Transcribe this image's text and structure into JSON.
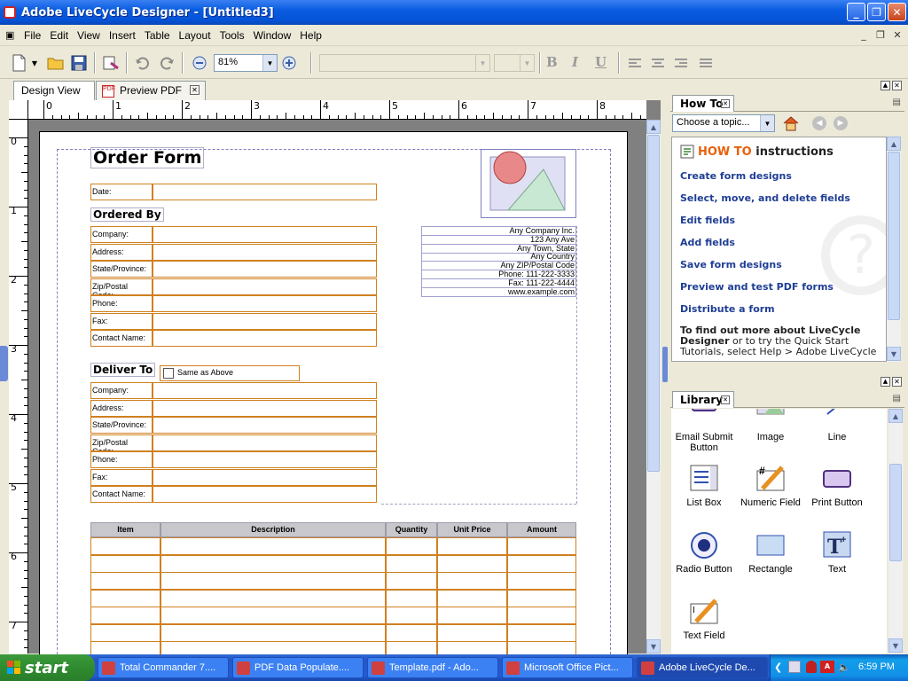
{
  "window": {
    "title": "Adobe LiveCycle Designer - [Untitled3]"
  },
  "menu": [
    "File",
    "Edit",
    "View",
    "Insert",
    "Table",
    "Layout",
    "Tools",
    "Window",
    "Help"
  ],
  "toolbar": {
    "zoom": "81%"
  },
  "tabs": [
    {
      "label": "Design View"
    },
    {
      "label": "Preview PDF"
    }
  ],
  "ruler": {
    "h_numbers": [
      "0",
      "1",
      "2",
      "3",
      "4",
      "5",
      "6",
      "7",
      "8"
    ],
    "v_numbers": [
      "0",
      "1",
      "2",
      "3",
      "4",
      "5",
      "6",
      "7"
    ]
  },
  "form": {
    "title": "Order Form",
    "date_label": "Date:",
    "ordered_by": "Ordered By",
    "deliver_to": "Deliver To",
    "same_as_above": "Same as Above",
    "address_fields": [
      "Company:",
      "Address:",
      "State/Province:",
      "Zip/Postal Code:",
      "Phone:",
      "Fax:",
      "Contact Name:"
    ],
    "company_info": [
      "Any Company Inc.",
      "123 Any Ave",
      "Any Town, State",
      "Any Country",
      "Any ZIP/Postal Code",
      "Phone: 111-222-3333",
      "Fax: 111-222-4444",
      "www.example.com"
    ],
    "table_headers": [
      "Item",
      "Description",
      "Quantity",
      "Unit Price",
      "Amount"
    ]
  },
  "howto": {
    "panel_title": "How To",
    "topic_placeholder": "Choose a topic...",
    "heading_strong": "HOW TO",
    "heading_rest": " instructions",
    "links": [
      "Create form designs",
      "Select, move, and delete fields",
      "Edit fields",
      "Add fields",
      "Save form designs",
      "Preview and test PDF forms",
      "Distribute a form"
    ],
    "note_bold1": "To find out more about LiveCycle Designer",
    "note_rest": " or to try the Quick Start Tutorials, select Help > Adobe LiveCycle"
  },
  "library": {
    "panel_title": "Library",
    "items": [
      {
        "label": "Email Submit Button",
        "icon": "email-submit-icon"
      },
      {
        "label": "Image",
        "icon": "image-icon"
      },
      {
        "label": "Line",
        "icon": "line-icon"
      },
      {
        "label": "List Box",
        "icon": "list-box-icon"
      },
      {
        "label": "Numeric Field",
        "icon": "numeric-field-icon"
      },
      {
        "label": "Print Button",
        "icon": "print-button-icon"
      },
      {
        "label": "Radio Button",
        "icon": "radio-button-icon"
      },
      {
        "label": "Rectangle",
        "icon": "rectangle-icon"
      },
      {
        "label": "Text",
        "icon": "text-icon"
      },
      {
        "label": "Text Field",
        "icon": "text-field-icon"
      }
    ]
  },
  "taskbar": {
    "start": "start",
    "buttons": [
      {
        "label": "Total Commander 7...."
      },
      {
        "label": "PDF Data Populate...."
      },
      {
        "label": "Template.pdf - Ado..."
      },
      {
        "label": "Microsoft Office Pict..."
      },
      {
        "label": "Adobe LiveCycle De..."
      }
    ],
    "clock": "6:59 PM"
  },
  "colors": {
    "titlebar": "#0a5ce0",
    "field_border": "#d08020",
    "link": "#1f3e95",
    "howto_orange": "#e8600a",
    "taskbar": "#245bd6",
    "start": "#2f8b2f"
  }
}
